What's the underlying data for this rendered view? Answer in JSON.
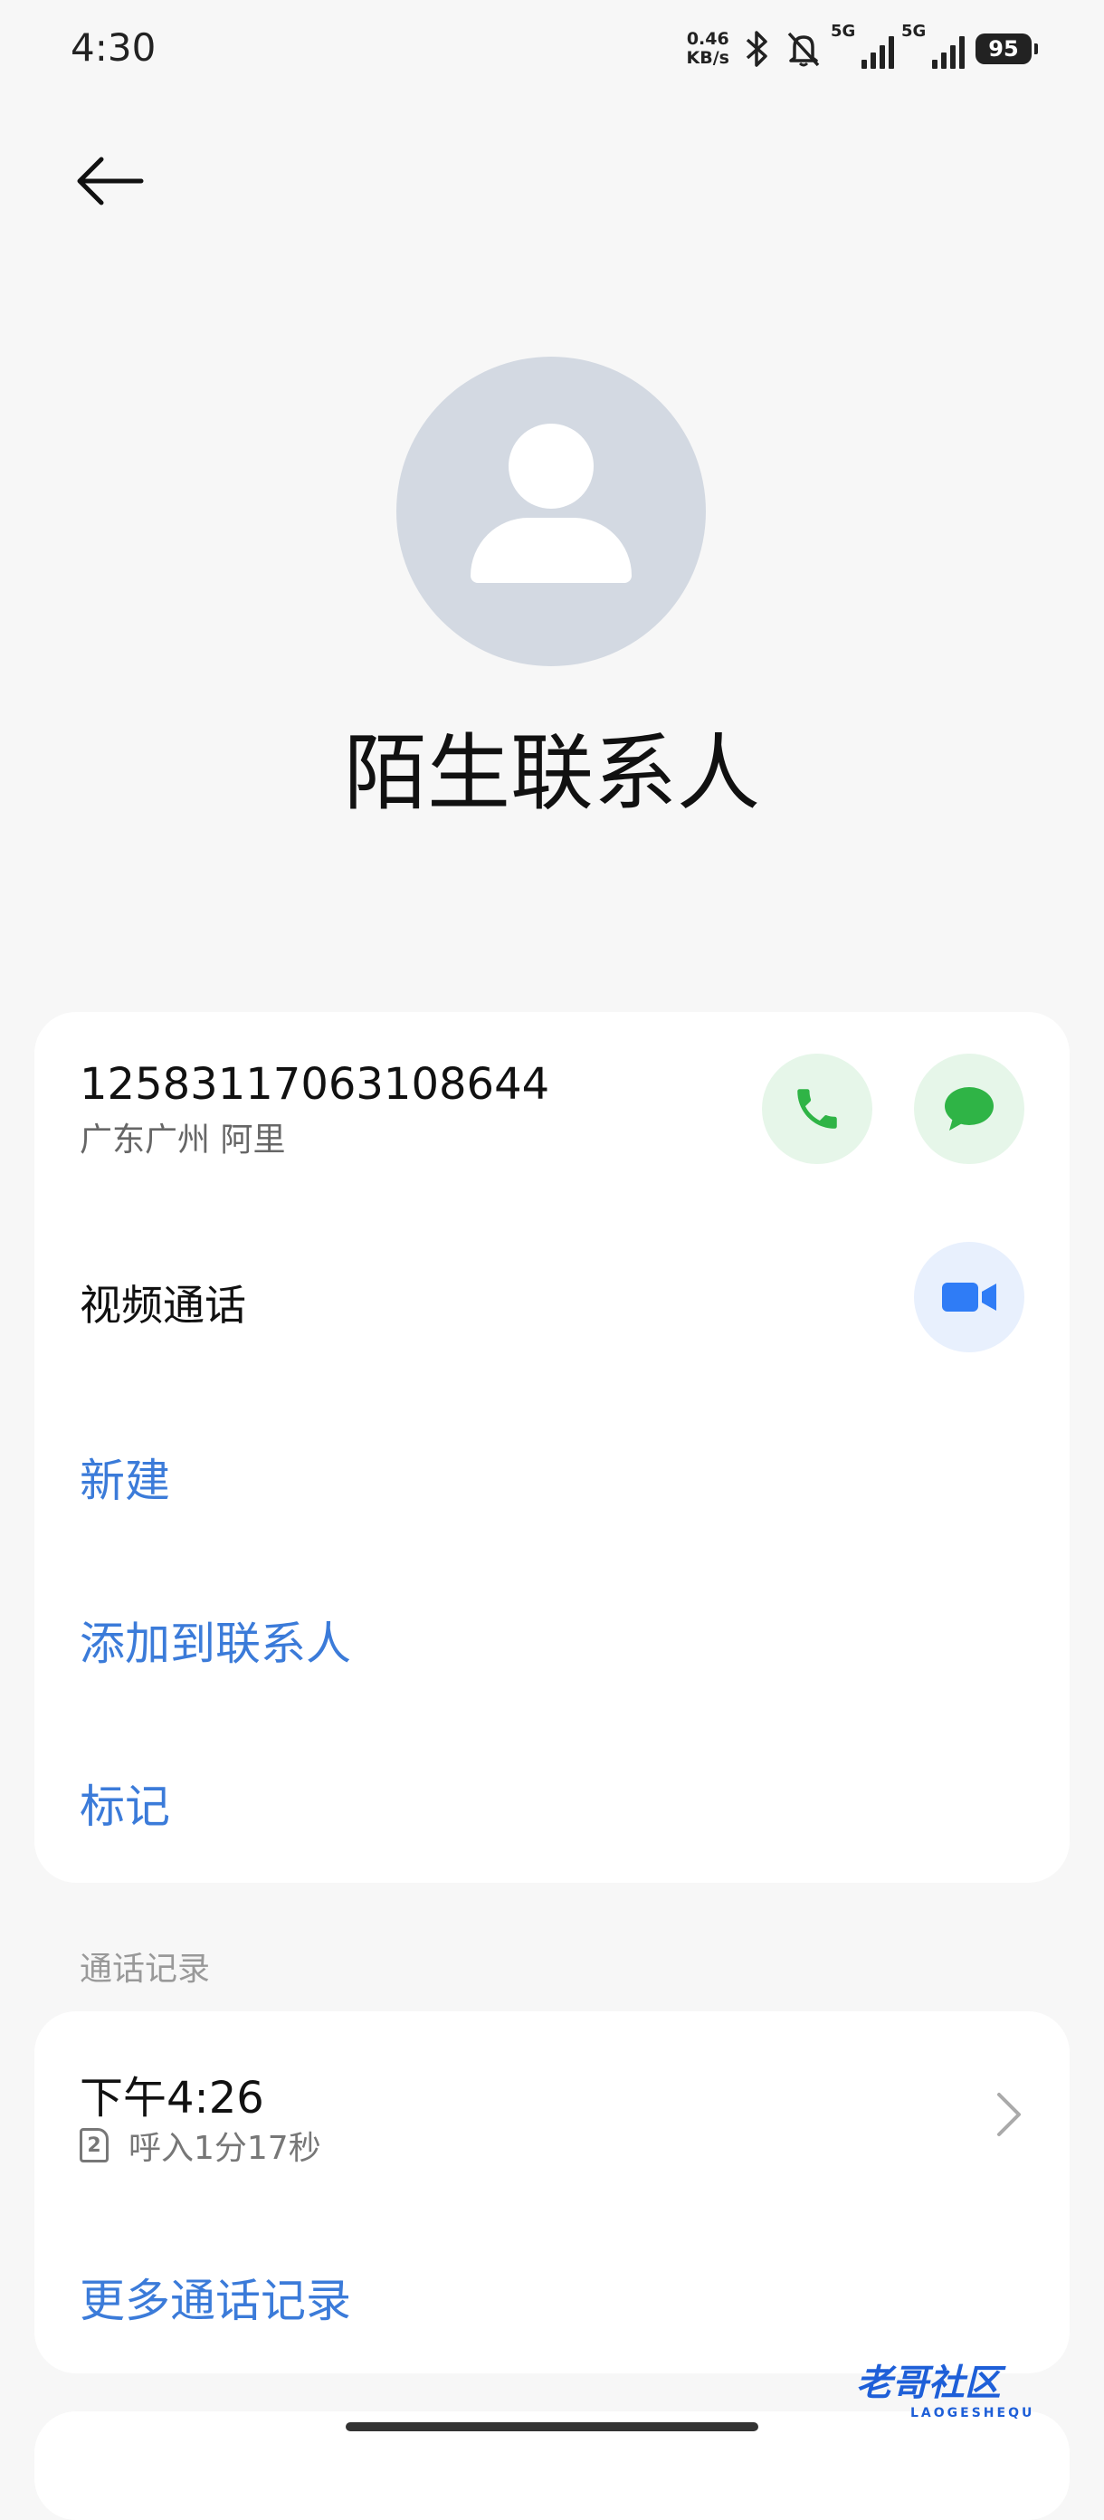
{
  "status_bar": {
    "time": "4:30",
    "net_speed_value": "0.46",
    "net_speed_unit": "KB/s",
    "sim1_label": "5G",
    "sim2_label": "5G",
    "battery": "95"
  },
  "contact": {
    "name": "陌生联系人",
    "number": "12583117063108644",
    "location": "广东广州 阿里"
  },
  "actions": {
    "video_call": "视频通话",
    "new": "新建",
    "add_to_contacts": "添加到联系人",
    "mark": "标记"
  },
  "call_log": {
    "section_title": "通话记录",
    "sim_slot": "2",
    "time": "下午4:26",
    "detail": "呼入1分17秒",
    "more": "更多通话记录"
  },
  "watermark": {
    "text": "老哥社区",
    "subtext": "LAOGESHEQU"
  },
  "colors": {
    "accent_blue": "#3b7bd9",
    "call_green": "#2fb446",
    "video_blue": "#2f7cf6",
    "avatar_bg": "#d3d9e2"
  }
}
